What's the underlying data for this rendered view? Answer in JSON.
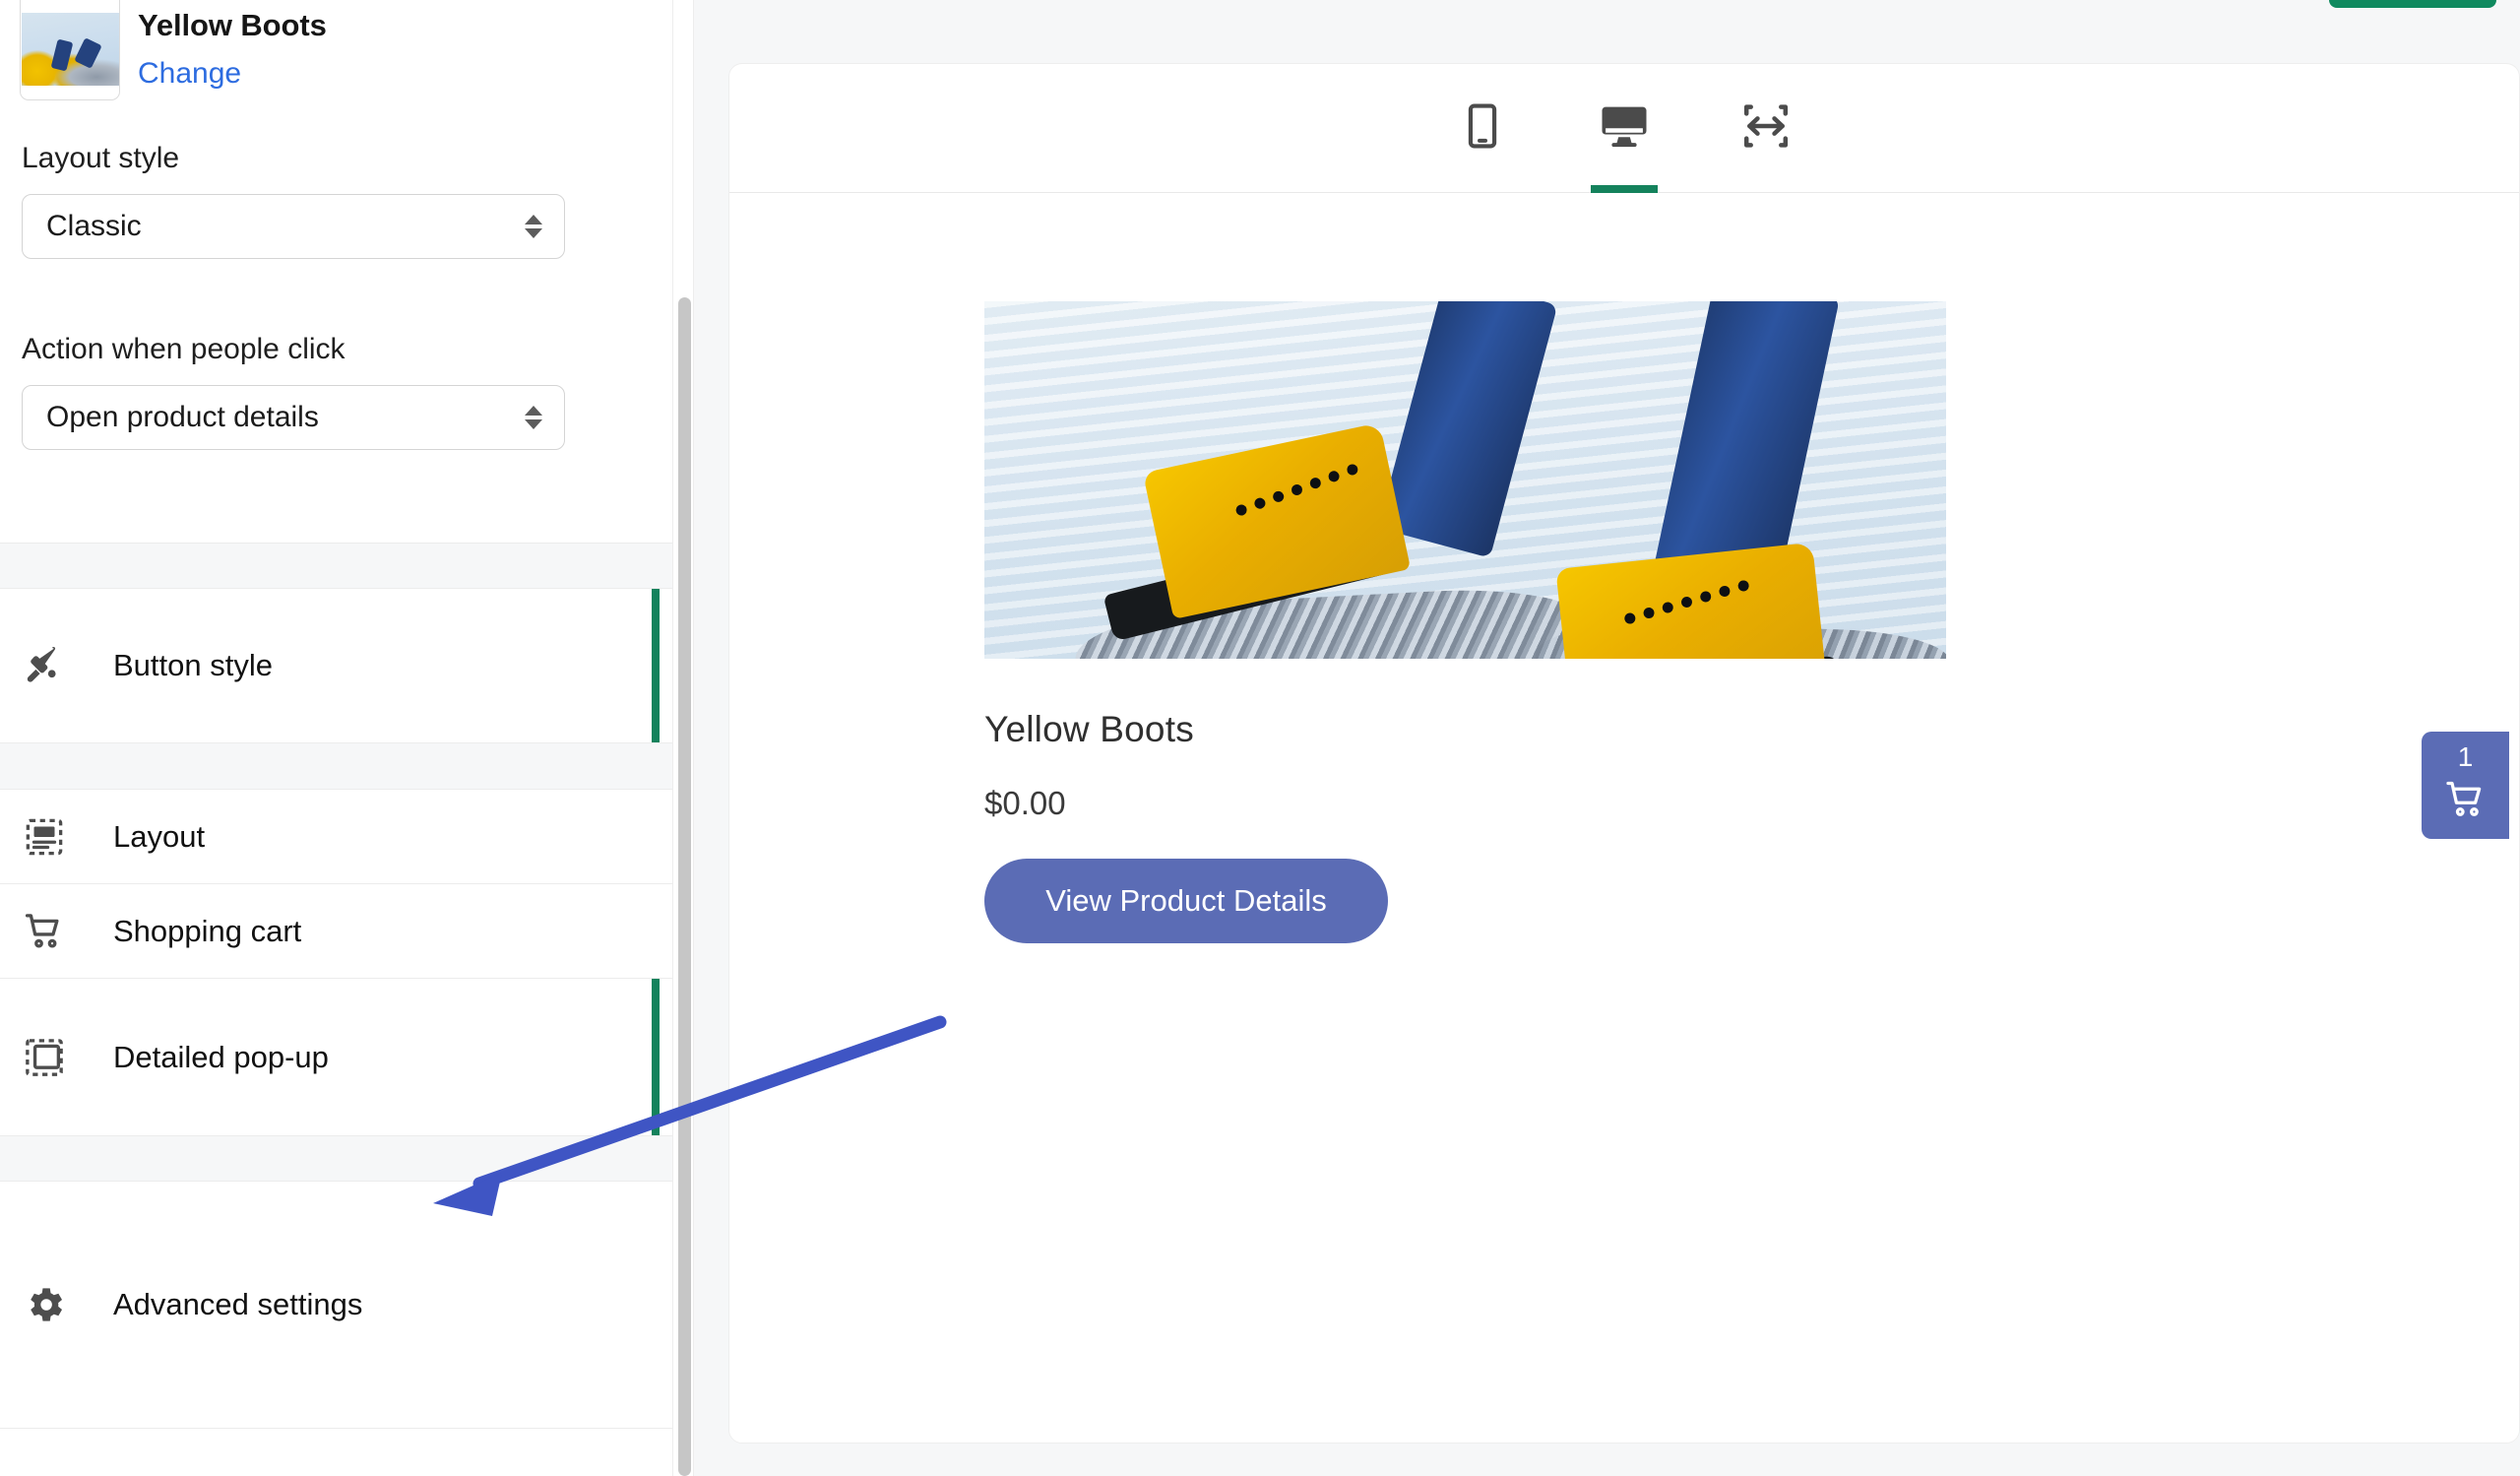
{
  "sidebar": {
    "product": {
      "title": "Yellow Boots",
      "change_label": "Change",
      "thumbnail_icon": "product-thumbnail-yellow-boots"
    },
    "fields": [
      {
        "label": "Layout style",
        "value": "Classic",
        "icon": "select-stepper-icon"
      },
      {
        "label": "Action when people click",
        "value": "Open product details",
        "icon": "select-stepper-icon"
      }
    ],
    "nav_items": [
      {
        "label": "Button style",
        "icon": "paint-brush-icon",
        "accent": true,
        "accent_color": "#14825c"
      },
      {
        "label": "Layout",
        "icon": "layout-frame-icon",
        "accent": false,
        "accent_color": "#14825c"
      },
      {
        "label": "Shopping cart",
        "icon": "shopping-cart-icon",
        "accent": false,
        "accent_color": "#14825c"
      },
      {
        "label": "Detailed pop-up",
        "icon": "popup-frame-icon",
        "accent": true,
        "accent_color": "#14825c"
      },
      {
        "label": "Advanced settings",
        "icon": "gear-icon",
        "accent": false,
        "accent_color": "#14825c"
      }
    ],
    "scrollbar": {
      "icon": "vertical-scrollbar"
    }
  },
  "preview": {
    "device_tabs": [
      {
        "icon": "mobile-phone-icon",
        "label": "Mobile",
        "active": false
      },
      {
        "icon": "desktop-monitor-icon",
        "label": "Desktop",
        "active": true
      },
      {
        "icon": "full-width-arrows-icon",
        "label": "Full width",
        "active": false
      }
    ],
    "active_tab_color": "#14825c",
    "product": {
      "image_icon": "yellow-boots-photo",
      "name": "Yellow Boots",
      "price": "$0.00",
      "cta_label": "View Product Details",
      "cta_color": "#5b6cb5"
    },
    "cart": {
      "count": "1",
      "icon": "shopping-cart-icon",
      "color": "#5b6cb5"
    },
    "top_action": {
      "icon": "green-action-pill",
      "color": "#0f8a5f"
    }
  },
  "annotation": {
    "arrow": {
      "icon": "arrow-pointing-left-icon",
      "color": "#3f55c4",
      "points_to": "Detailed pop-up"
    }
  }
}
